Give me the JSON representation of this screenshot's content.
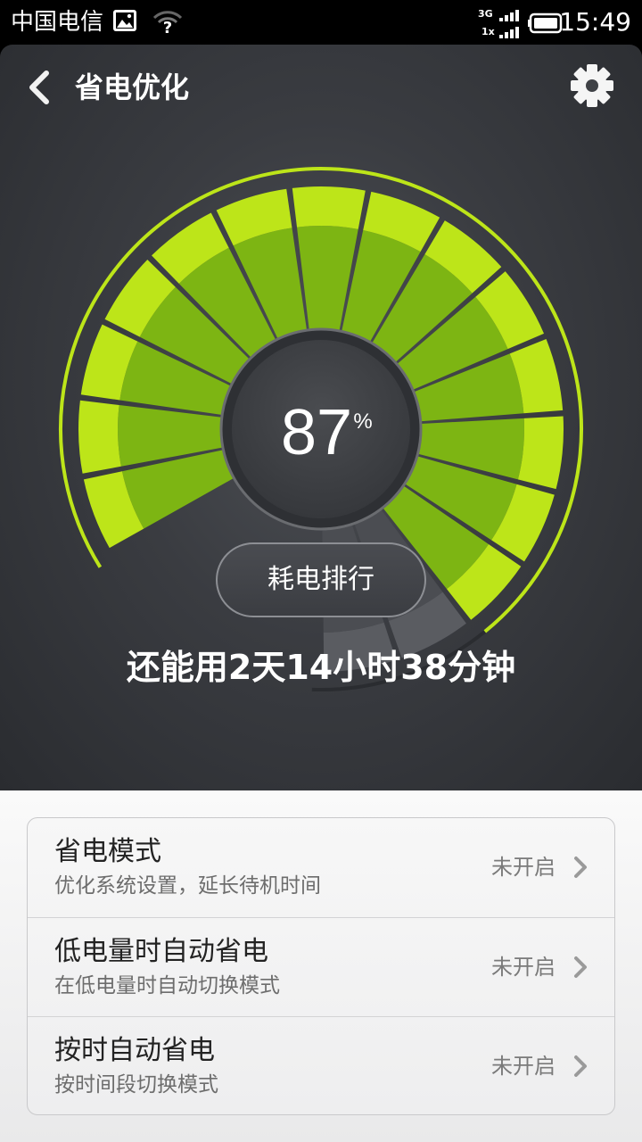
{
  "status_bar": {
    "carrier": "中国电信",
    "network_top": "3G",
    "network_bottom": "1x",
    "time": "15:49",
    "icons": [
      "image-icon",
      "wifi-unknown-icon",
      "signal-icon",
      "battery-icon"
    ]
  },
  "header": {
    "title": "省电优化",
    "back_icon": "back-arrow-icon",
    "settings_icon": "gear-icon"
  },
  "gauge": {
    "percent_value": "87",
    "percent_unit": "%",
    "level_fraction": 0.87,
    "active_color": "#bde519",
    "inactive_color": "#5a5c61"
  },
  "rank_button": {
    "label": "耗电排行"
  },
  "remaining_time": "还能用2天14小时38分钟",
  "settings": [
    {
      "title": "省电模式",
      "subtitle": "优化系统设置，延长待机时间",
      "status": "未开启"
    },
    {
      "title": "低电量时自动省电",
      "subtitle": "在低电量时自动切换模式",
      "status": "未开启"
    },
    {
      "title": "按时自动省电",
      "subtitle": "按时间段切换模式",
      "status": "未开启"
    }
  ]
}
